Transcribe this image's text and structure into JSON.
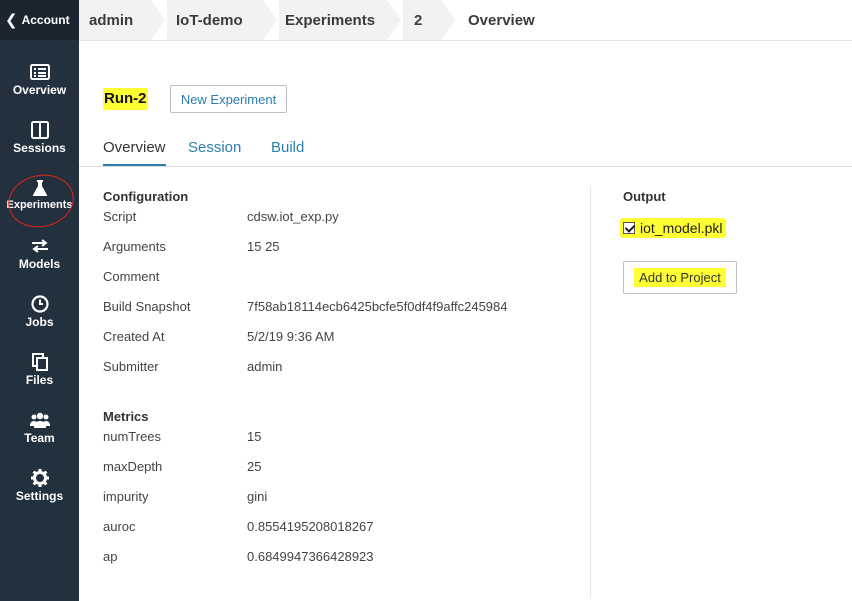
{
  "sidebar": {
    "account_label": "Account",
    "items": [
      {
        "label": "Overview",
        "icon": "list-icon"
      },
      {
        "label": "Sessions",
        "icon": "columns-icon"
      },
      {
        "label": "Experiments",
        "icon": "flask-icon"
      },
      {
        "label": "Models",
        "icon": "arrows-icon"
      },
      {
        "label": "Jobs",
        "icon": "clock-icon"
      },
      {
        "label": "Files",
        "icon": "files-icon"
      },
      {
        "label": "Team",
        "icon": "team-icon"
      },
      {
        "label": "Settings",
        "icon": "gear-icon"
      }
    ]
  },
  "breadcrumb": [
    "admin",
    "IoT-demo",
    "Experiments",
    "2",
    "Overview"
  ],
  "header": {
    "run_title": "Run-2",
    "new_experiment_label": "New Experiment"
  },
  "tabs": [
    "Overview",
    "Session",
    "Build"
  ],
  "configuration": {
    "title": "Configuration",
    "rows": [
      {
        "key": "Script",
        "value": "cdsw.iot_exp.py"
      },
      {
        "key": "Arguments",
        "value": "15 25"
      },
      {
        "key": "Comment",
        "value": ""
      },
      {
        "key": "Build Snapshot",
        "value": "7f58ab18114ecb6425bcfe5f0df4f9affc245984"
      },
      {
        "key": "Created At",
        "value": "5/2/19 9:36 AM"
      },
      {
        "key": "Submitter",
        "value": "admin"
      }
    ]
  },
  "metrics": {
    "title": "Metrics",
    "rows": [
      {
        "key": "numTrees",
        "value": "15"
      },
      {
        "key": "maxDepth",
        "value": "25"
      },
      {
        "key": "impurity",
        "value": "gini"
      },
      {
        "key": "auroc",
        "value": "0.8554195208018267"
      },
      {
        "key": "ap",
        "value": "0.6849947366428923"
      }
    ]
  },
  "output": {
    "title": "Output",
    "file_name": "iot_model.pkl",
    "file_checked": true,
    "add_to_project_label": "Add to Project"
  },
  "colors": {
    "sidebar_bg": "#23303d",
    "link_blue": "#2b7fa9",
    "highlight": "#ffff33",
    "annotation_red": "#e3241b"
  }
}
